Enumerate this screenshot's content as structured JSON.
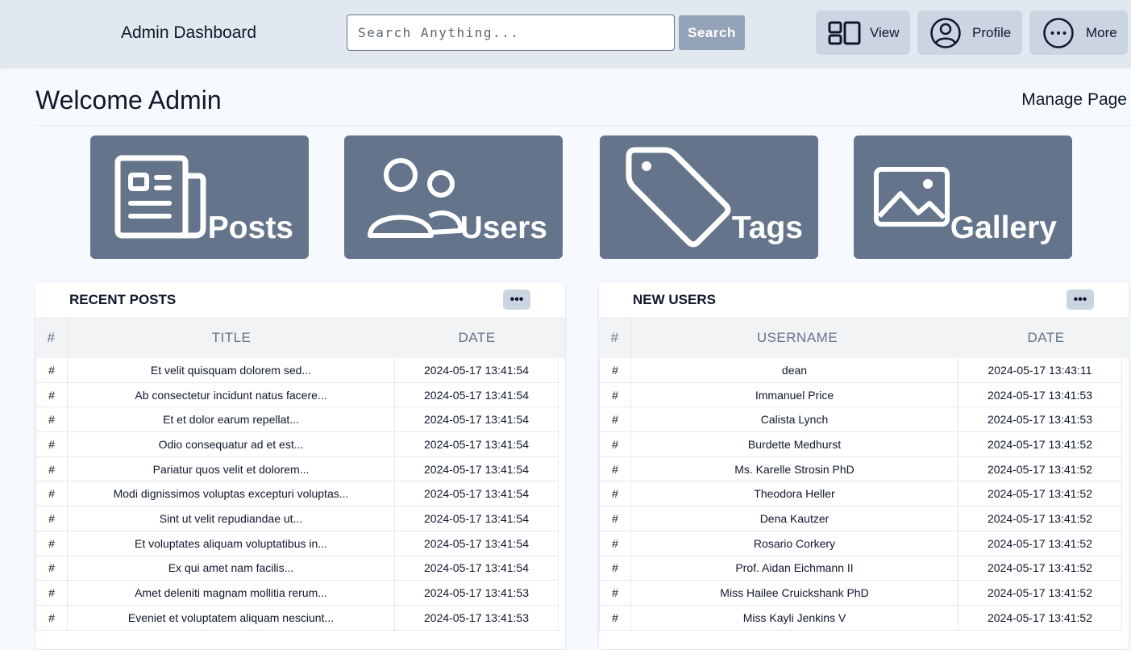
{
  "header": {
    "brand": "Admin Dashboard",
    "search_placeholder": "Search Anything...",
    "search_button": "Search",
    "view_label": "View",
    "profile_label": "Profile",
    "more_label": "More"
  },
  "welcome": {
    "title": "Welcome Admin",
    "manage_link": "Manage Page"
  },
  "cards": {
    "posts": "Posts",
    "users": "Users",
    "tags": "Tags",
    "gallery": "Gallery"
  },
  "recent_posts": {
    "title": "RECENT POSTS",
    "menu_label": "•••",
    "columns": [
      "#",
      "TITLE",
      "DATE"
    ],
    "rows": [
      [
        "#",
        "Et velit quisquam dolorem sed...",
        "2024-05-17 13:41:54"
      ],
      [
        "#",
        "Ab consectetur incidunt natus facere...",
        "2024-05-17 13:41:54"
      ],
      [
        "#",
        "Et et dolor earum repellat...",
        "2024-05-17 13:41:54"
      ],
      [
        "#",
        "Odio consequatur ad et est...",
        "2024-05-17 13:41:54"
      ],
      [
        "#",
        "Pariatur quos velit et dolorem...",
        "2024-05-17 13:41:54"
      ],
      [
        "#",
        "Modi dignissimos voluptas excepturi voluptas...",
        "2024-05-17 13:41:54"
      ],
      [
        "#",
        "Sint ut velit repudiandae ut...",
        "2024-05-17 13:41:54"
      ],
      [
        "#",
        "Et voluptates aliquam voluptatibus in...",
        "2024-05-17 13:41:54"
      ],
      [
        "#",
        "Ex qui amet nam facilis...",
        "2024-05-17 13:41:54"
      ],
      [
        "#",
        "Amet deleniti magnam mollitia rerum...",
        "2024-05-17 13:41:53"
      ],
      [
        "#",
        "Eveniet et voluptatem aliquam nesciunt...",
        "2024-05-17 13:41:53"
      ]
    ]
  },
  "new_users": {
    "title": "NEW USERS",
    "menu_label": "•••",
    "columns": [
      "#",
      "USERNAME",
      "DATE"
    ],
    "rows": [
      [
        "#",
        "dean",
        "2024-05-17 13:43:11"
      ],
      [
        "#",
        "Immanuel Price",
        "2024-05-17 13:41:53"
      ],
      [
        "#",
        "Calista Lynch",
        "2024-05-17 13:41:53"
      ],
      [
        "#",
        "Burdette Medhurst",
        "2024-05-17 13:41:52"
      ],
      [
        "#",
        "Ms. Karelle Strosin PhD",
        "2024-05-17 13:41:52"
      ],
      [
        "#",
        "Theodora Heller",
        "2024-05-17 13:41:52"
      ],
      [
        "#",
        "Dena Kautzer",
        "2024-05-17 13:41:52"
      ],
      [
        "#",
        "Rosario Corkery",
        "2024-05-17 13:41:52"
      ],
      [
        "#",
        "Prof. Aidan Eichmann II",
        "2024-05-17 13:41:52"
      ],
      [
        "#",
        "Miss Hailee Cruickshank PhD",
        "2024-05-17 13:41:52"
      ],
      [
        "#",
        "Miss Kayli Jenkins V",
        "2024-05-17 13:41:52"
      ]
    ]
  }
}
